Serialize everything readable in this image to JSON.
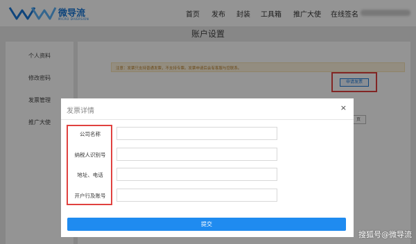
{
  "brand": {
    "name": "微导流",
    "subtitle": "MICRO DIVERSION",
    "color": "#1a78d6"
  },
  "nav": {
    "items": [
      "首页",
      "发布",
      "封装",
      "工具箱",
      "推广大使",
      "在线签名"
    ]
  },
  "page": {
    "title": "账户设置"
  },
  "sidebar": {
    "items": [
      "个人资料",
      "修改密码",
      "发票管理",
      "推广大使"
    ]
  },
  "main": {
    "notice": "注意：发票只支持普通发票，不支持专票。发票申请后会有客服与您联系。",
    "apply_button": "申请发票",
    "page_button": "页"
  },
  "modal": {
    "title": "发票详情",
    "close_icon": "close-icon",
    "fields": [
      {
        "label": "公司名称",
        "value": "",
        "placeholder": ""
      },
      {
        "label": "纳税人识别号",
        "value": "",
        "placeholder": ""
      },
      {
        "label": "地址、电话",
        "value": "",
        "placeholder": ""
      },
      {
        "label": "开户行及账号",
        "value": "",
        "placeholder": ""
      }
    ],
    "submit_label": "提交"
  },
  "colors": {
    "accent": "#1f8bf0",
    "highlight": "#e0413f",
    "notice_bg": "#fdf3dc"
  },
  "watermark": "搜狐号@微导流"
}
